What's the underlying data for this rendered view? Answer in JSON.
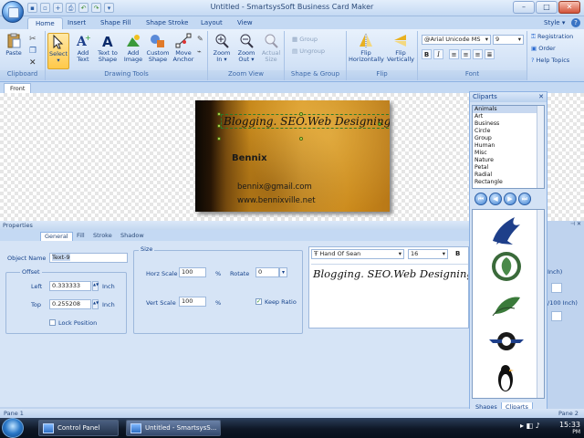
{
  "window": {
    "title": "Untitled - SmartsysSoft Business Card Maker",
    "style_label": "Style"
  },
  "tabs": [
    "Home",
    "Insert",
    "Shape Fill",
    "Shape Stroke",
    "Layout",
    "View"
  ],
  "ribbon": {
    "clipboard": {
      "label": "Clipboard",
      "paste": "Paste"
    },
    "drawing_tools": {
      "label": "Drawing Tools",
      "select": "Select",
      "add_text": "Add Text",
      "text_to_shape": "Text to Shape",
      "add_image": "Add Image",
      "custom_shape": "Custom Shape",
      "move_anchor": "Move Anchor"
    },
    "zoom_view": {
      "label": "Zoom View",
      "zoom_in": "Zoom In",
      "zoom_out": "Zoom Out",
      "actual_size": "Actual Size"
    },
    "shape_group": {
      "label": "Shape & Group",
      "group": "Group",
      "ungroup": "Ungroup"
    },
    "flip": {
      "label": "Flip",
      "flip_h": "Flip Horizontally",
      "flip_v": "Flip Vertically"
    },
    "font": {
      "label": "Font",
      "family": "@Arial Unicode MS",
      "size": "9"
    },
    "help": {
      "registration": "Registration",
      "order": "Order",
      "help_topics": "Help Topics"
    }
  },
  "document_tab": "Front",
  "card": {
    "headline": "Blogging. SEO.Web Designing",
    "name": "Bennix",
    "email": "bennix@gmail.com",
    "website": "www.bennixville.net"
  },
  "properties": {
    "header": "Properties",
    "tabs": [
      "General",
      "Fill",
      "Stroke",
      "Shadow"
    ],
    "object_name_label": "Object Name",
    "object_name": "Text-9",
    "offset_label": "Offset",
    "left_label": "Left",
    "left_value": "0.333333",
    "top_label": "Top",
    "top_value": "0.255208",
    "unit": "Inch",
    "lock_position": "Lock Position",
    "size_label": "Size",
    "horz_scale_label": "Horz Scale",
    "horz_scale": "100",
    "vert_scale_label": "Vert Scale",
    "vert_scale": "100",
    "percent": "%",
    "rotate_label": "Rotate",
    "rotate": "0",
    "keep_ratio": "Keep Ratio",
    "font_family": "Hand Of Sean",
    "font_size": "16",
    "bold": "B",
    "preview_text": "Blogging. SEO.Web Designing",
    "right_unit1": "Inch)",
    "right_unit2": "/100 Inch)"
  },
  "cliparts": {
    "header": "Cliparts",
    "categories": [
      "Animals",
      "Art",
      "Business",
      "Circle",
      "Group",
      "Human",
      "Misc",
      "Nature",
      "Petal",
      "Radial",
      "Rectangle"
    ],
    "selected": "Animals",
    "bottom_tabs": [
      "Shapes",
      "Cliparts"
    ],
    "items": [
      "bird-clipart",
      "leaf-emblem-clipart",
      "leaves-clipart",
      "winged-emblem-clipart",
      "penguin-clipart"
    ]
  },
  "status": {
    "left": "Pane 1",
    "right": "Pane 2"
  },
  "taskbar": {
    "items": [
      "Control Panel",
      "Untitled - SmartsysS..."
    ],
    "time": "15:33",
    "period": "PM"
  }
}
